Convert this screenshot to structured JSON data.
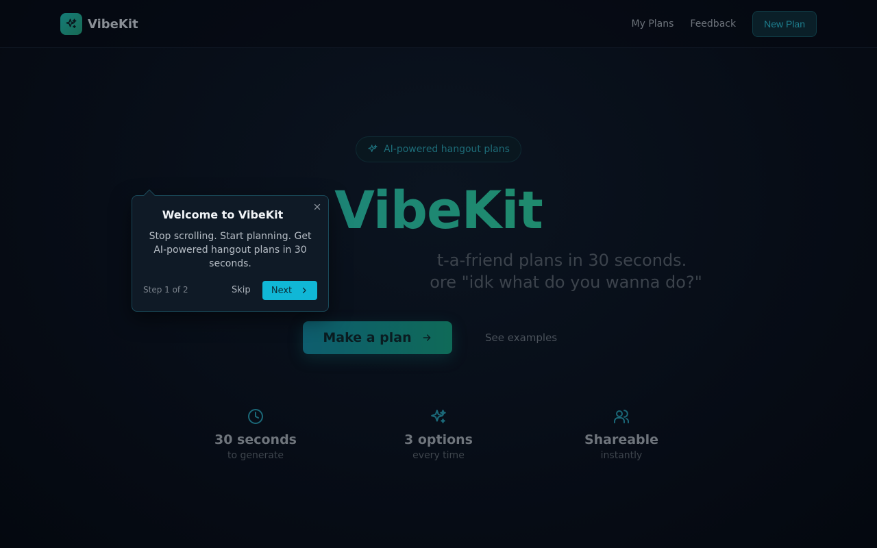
{
  "nav": {
    "brand": "VibeKit",
    "links": [
      "My Plans",
      "Feedback"
    ],
    "new_plan": "New Plan"
  },
  "hero": {
    "badge": "AI-powered hangout plans",
    "title": "VibeKit",
    "subtitle_line1": "t-a-friend plans in 30 seconds.",
    "subtitle_line2": "ore \"idk what do you wanna do?\"",
    "cta": "Make a plan",
    "secondary": "See examples"
  },
  "features": [
    {
      "icon": "clock-icon",
      "title": "30 seconds",
      "sub": "to generate"
    },
    {
      "icon": "sparkles-icon",
      "title": "3 options",
      "sub": "every time"
    },
    {
      "icon": "users-icon",
      "title": "Shareable",
      "sub": "instantly"
    }
  ],
  "tour": {
    "title": "Welcome to VibeKit",
    "body": "Stop scrolling. Start planning. Get AI-powered hangout plans in 30 seconds.",
    "step": "Step 1 of 2",
    "skip": "Skip",
    "next": "Next"
  },
  "colors": {
    "accent": "#10b7d6",
    "brand_gradient_start": "#1a7f86",
    "brand_gradient_end": "#27845a"
  }
}
